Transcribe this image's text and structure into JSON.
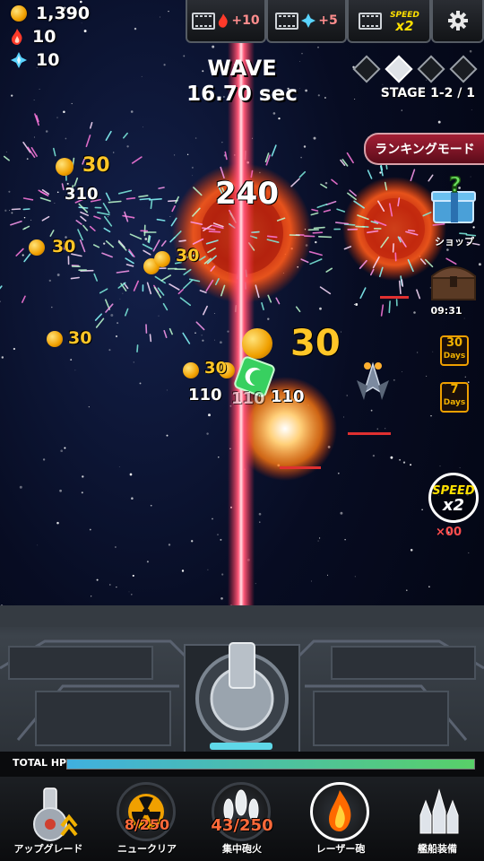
{
  "currencies": {
    "coins": "1,390",
    "fire": "10",
    "gems": "10"
  },
  "boosters": [
    {
      "value": "+10",
      "icon": "fire-icon"
    },
    {
      "value": "+5",
      "icon": "gem-icon"
    },
    {
      "label_top": "SPEED",
      "label_bottom": "x2"
    }
  ],
  "settings_icon": "gear-icon",
  "wave": {
    "title": "WAVE",
    "time": "16.70 sec"
  },
  "stage": "STAGE 1-2 / 1",
  "ranking_button": "ランキングモード",
  "shop": {
    "label": "ショップ",
    "icon": "gift-box-icon"
  },
  "chest": {
    "timer": "09:31",
    "icon": "treasure-chest-icon"
  },
  "days_30": {
    "number": "30",
    "label": "Days"
  },
  "days_7": {
    "number": "7",
    "label": "Days"
  },
  "speed_button": {
    "top": "SPEED",
    "bottom": "x2",
    "count": "×00"
  },
  "damage_numbers": {
    "big_240": "240",
    "gold_30_a": "30",
    "gold_30_b": "30",
    "gold_30_c": "30",
    "gold_30_d": "30",
    "gold_30_big": "30",
    "gold_30_e": "30",
    "white_310": "310",
    "white_110_a": "110",
    "white_110_b": "110",
    "white_110_c": "110"
  },
  "total_hp": {
    "label": "TOTAL HP",
    "fraction": 1.0
  },
  "menu": [
    {
      "label": "アップグレード",
      "icon": "upgrade-turret-icon",
      "count": ""
    },
    {
      "label": "ニュークリア",
      "icon": "nuclear-icon",
      "count": "8/250"
    },
    {
      "label": "集中砲火",
      "icon": "missiles-icon",
      "count": "43/250"
    },
    {
      "label": "レーザー砲",
      "icon": "laser-flame-icon",
      "count": ""
    },
    {
      "label": "艦船装備",
      "icon": "ship-equipment-icon",
      "count": ""
    }
  ],
  "colors": {
    "gold": "#ffc627",
    "laser": "#ff4a6a",
    "hp_start": "#40b0e0",
    "hp_end": "#58d068",
    "rank_button": "#a31f35"
  }
}
